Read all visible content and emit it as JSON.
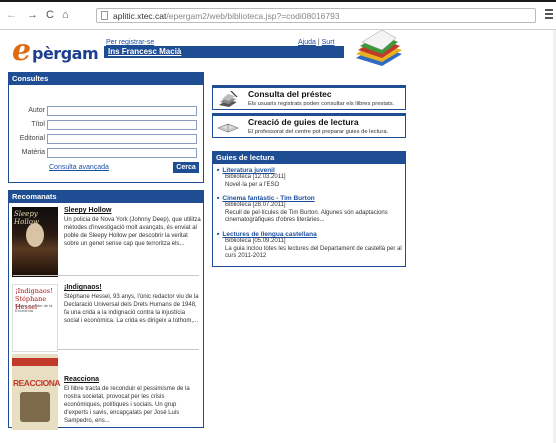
{
  "browser": {
    "url_host": "aplitic.xtec.cat",
    "url_path": "/epergam2/web/biblioteca.jsp?=codi08016793"
  },
  "header": {
    "logo_e": "e",
    "logo_rest": "pèrgam",
    "register_link": "Per registrar-se",
    "help_link": "Ajuda",
    "separator": "|",
    "exit_link": "Surt",
    "institution": "Ins Francesc Macià"
  },
  "consultes": {
    "title": "Consultes",
    "fields": [
      {
        "label": "Autor",
        "value": ""
      },
      {
        "label": "Títol",
        "value": ""
      },
      {
        "label": "Editorial",
        "value": ""
      },
      {
        "label": "Matèria",
        "value": ""
      }
    ],
    "advanced_link": "Consulta avançada",
    "search_button": "Cerca"
  },
  "recomanats": {
    "title": "Recomanats",
    "items": [
      {
        "cover_text": "Sleepy Hollow",
        "title": "Sleepy Hollow",
        "description": "Un policia de Nova York (Johnny Deep), que utilitza mètodes d'investigació molt avançats, és enviat al poble de Sleepy Hollow per descobrir la veritat sobre un genet sense cap que terroritza els..."
      },
      {
        "cover_text": "¡Indignaos! Stéphane Hessel",
        "cover_sub": "Contra el poder de la Economía",
        "title": "¡Indignaos!",
        "description": "Stéphane Hessel, 93 anys, l'únic redactor viu de la Declaració Universal dels Drets Humans de 1948, fa una crida a la indignació contra la injustícia social i econòmica. La crida es dirigeix a tothom,..."
      },
      {
        "cover_text": "REACCIONA",
        "title": "Reacciona",
        "description": "El llibre tracta de reconduir el pessimisme de la nostra societat, provocat per les crisis econòmiques, polítiques i socials. Un grup d'experts i savis, encapçalats per José Luis Sampedro, ens..."
      }
    ]
  },
  "consulta_prestec": {
    "title": "Consulta del préstec",
    "description": "Els usuaris registrats poden consultar els llibres prestats."
  },
  "creacio_guies": {
    "title": "Creació de guies de lectura",
    "description": "El professorat del centre pot preparar guies de lectura."
  },
  "guies": {
    "title": "Guies de lectura",
    "items": [
      {
        "title": "Literatura juvenil",
        "meta": "Biblioteca [12.03.2011]",
        "desc": "Novel·la per a l'ESO"
      },
      {
        "title": "Cinema fantàstic - Tim Burton",
        "meta": "Biblioteca [28.07.2011]",
        "desc": "Recull de pel·lícules de Tim Burton. Algunes són adaptacions cinematogràfiques d'obres literàries..."
      },
      {
        "title": "Lectures de llengua castellana",
        "meta": "Biblioteca [05.09.2011]",
        "desc": "La guia inclou totes les lectures del Departament de castellà per al curs 2011-2012"
      }
    ]
  }
}
